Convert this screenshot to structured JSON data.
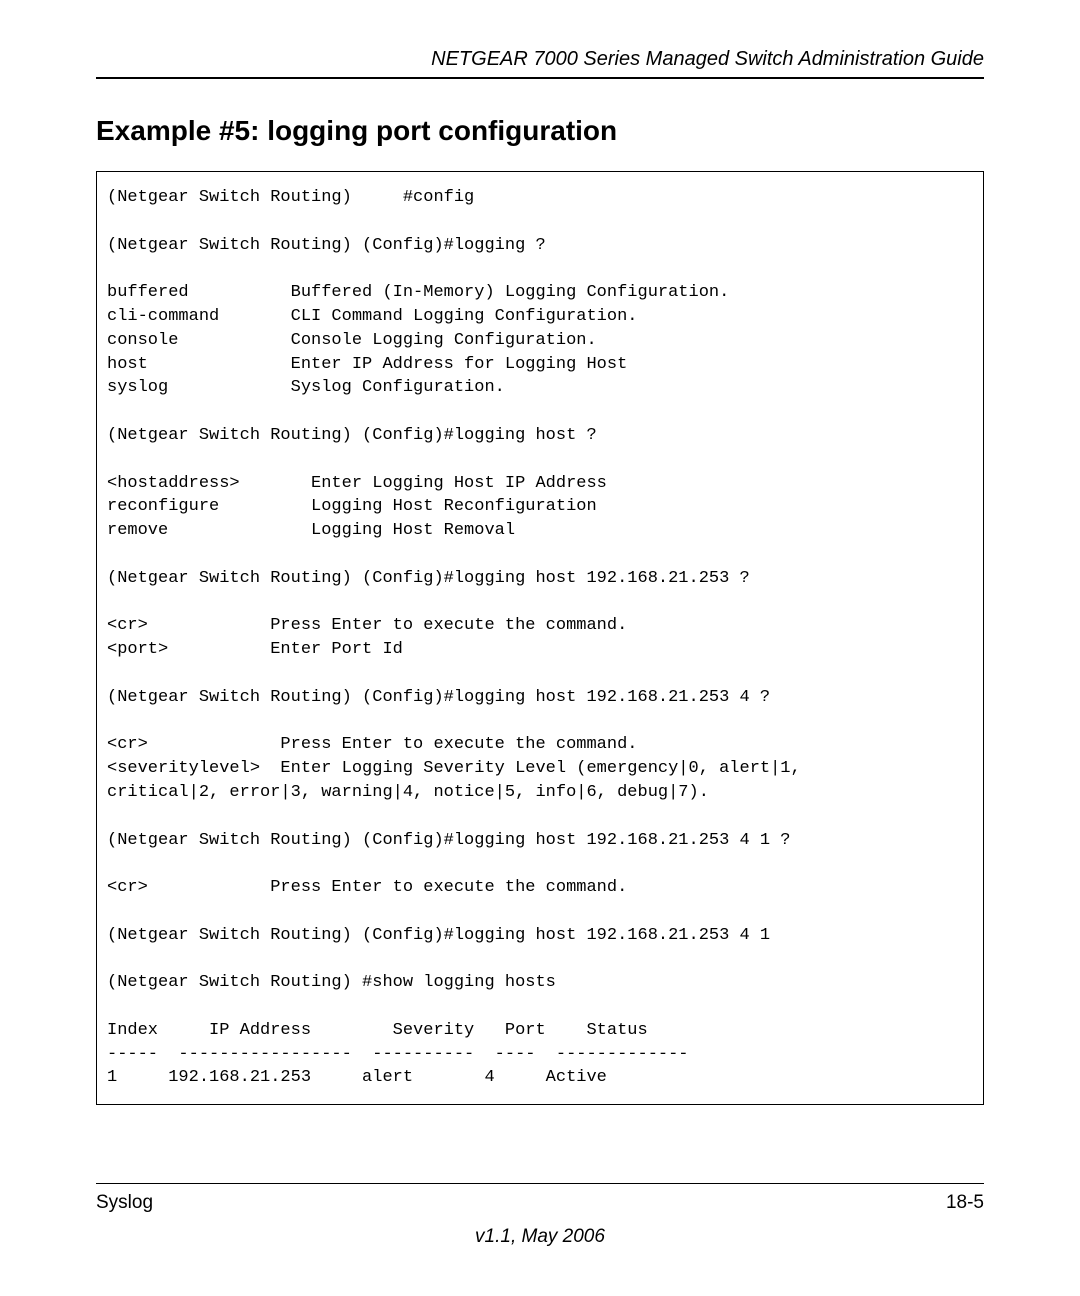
{
  "header": {
    "title": "NETGEAR 7000  Series Managed Switch Administration Guide"
  },
  "section": {
    "heading": "Example #5: logging port configuration"
  },
  "code_lines": [
    "(Netgear Switch Routing)     #config",
    "",
    "(Netgear Switch Routing) (Config)#logging ?",
    "",
    "buffered          Buffered (In-Memory) Logging Configuration.",
    "cli-command       CLI Command Logging Configuration.",
    "console           Console Logging Configuration.",
    "host              Enter IP Address for Logging Host",
    "syslog            Syslog Configuration.",
    "",
    "(Netgear Switch Routing) (Config)#logging host ?",
    "",
    "<hostaddress>       Enter Logging Host IP Address",
    "reconfigure         Logging Host Reconfiguration",
    "remove              Logging Host Removal",
    "",
    "(Netgear Switch Routing) (Config)#logging host 192.168.21.253 ?",
    "",
    "<cr>            Press Enter to execute the command.",
    "<port>          Enter Port Id",
    "",
    "(Netgear Switch Routing) (Config)#logging host 192.168.21.253 4 ?",
    "",
    "<cr>             Press Enter to execute the command.",
    "<severitylevel>  Enter Logging Severity Level (emergency|0, alert|1,",
    "critical|2, error|3, warning|4, notice|5, info|6, debug|7).",
    "",
    "(Netgear Switch Routing) (Config)#logging host 192.168.21.253 4 1 ?",
    "",
    "<cr>            Press Enter to execute the command.",
    "",
    "(Netgear Switch Routing) (Config)#logging host 192.168.21.253 4 1",
    "",
    "(Netgear Switch Routing) #show logging hosts",
    "",
    "Index     IP Address        Severity   Port    Status",
    "-----  -----------------  ----------  ----  -------------",
    "1     192.168.21.253     alert       4     Active"
  ],
  "footer": {
    "left": "Syslog",
    "right": "18-5",
    "version": "v1.1, May 2006"
  }
}
